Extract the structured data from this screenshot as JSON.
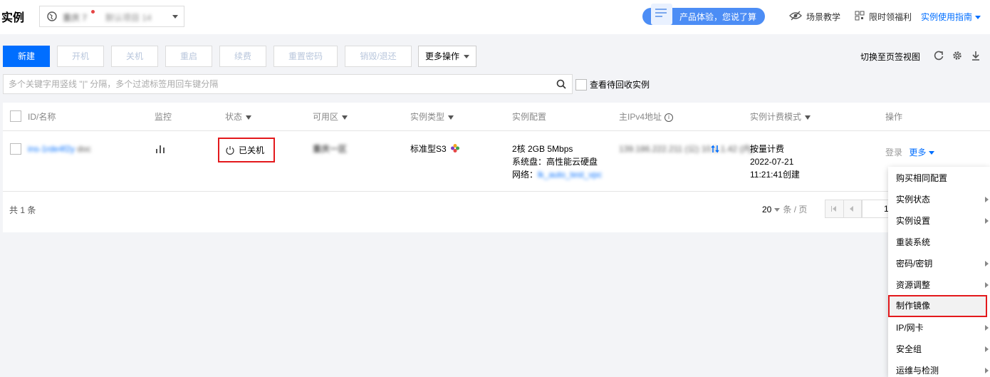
{
  "header": {
    "title": "实例",
    "region": {
      "name": "重庆 7",
      "extra": "默认项目 14"
    },
    "promo": "产品体验，您说了算",
    "links": [
      "场景教学",
      "限时领福利"
    ],
    "guide": "实例使用指南"
  },
  "toolbar": {
    "buttons": [
      "新建",
      "开机",
      "关机",
      "重启",
      "续费",
      "重置密码",
      "销毁/退还"
    ],
    "more": "更多操作",
    "switch_tab": "切换至页签视图"
  },
  "search": {
    "placeholder": "多个关键字用竖线 \"|\" 分隔，多个过滤标签用回车键分隔",
    "recycle_label": "查看待回收实例"
  },
  "table": {
    "headers": [
      "ID/名称",
      "监控",
      "状态",
      "可用区",
      "实例类型",
      "实例配置",
      "主IPv4地址",
      "实例计费模式",
      "操作"
    ],
    "row": {
      "id": "ins-1rde4f2y",
      "name": "doc",
      "status": "已关机",
      "zone": "重庆一区",
      "type": "标准型S3",
      "config_line1": "2核 2GB 5Mbps",
      "config_line2": "系统盘：高性能云硬盘",
      "config_line3_label": "网络：",
      "config_line3_value": "lk_auto_test_vpc",
      "ip_public": "139.186.222.211 (公)",
      "ip_private": "10.1.1.42 (内)",
      "billing": "按量计费",
      "created_date": "2022-07-21",
      "created_time": "11:21:41创建",
      "login": "登录",
      "more": "更多"
    },
    "footer": {
      "total": "共 1 条",
      "page_size": "20",
      "page_size_unit": "条 / 页",
      "page": "1"
    }
  },
  "menu": {
    "items": [
      {
        "label": "购买相同配置",
        "submenu": false
      },
      {
        "label": "实例状态",
        "submenu": true
      },
      {
        "label": "实例设置",
        "submenu": true
      },
      {
        "label": "重装系统",
        "submenu": false
      },
      {
        "label": "密码/密钥",
        "submenu": true
      },
      {
        "label": "资源调整",
        "submenu": true
      },
      {
        "label": "制作镜像",
        "submenu": false,
        "highlighted": true
      },
      {
        "label": "IP/网卡",
        "submenu": true
      },
      {
        "label": "安全组",
        "submenu": true
      },
      {
        "label": "运维与检测",
        "submenu": true
      }
    ]
  },
  "colors": {
    "accent": "#006eff",
    "highlight": "#e3191c"
  }
}
